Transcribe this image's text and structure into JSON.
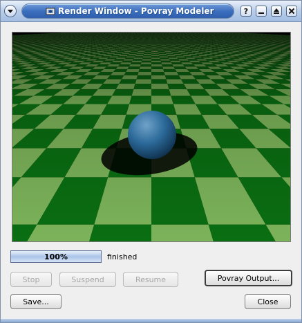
{
  "window": {
    "title": "Render Window - Povray Modeler",
    "help_label": "?",
    "minimize_label": "",
    "maximize_label": "",
    "close_label": ""
  },
  "render": {
    "progress_text": "100%",
    "progress_fraction": 1.0,
    "status": "finished"
  },
  "buttons": {
    "stop": "Stop",
    "suspend": "Suspend",
    "resume": "Resume",
    "povray_output": "Povray Output...",
    "save": "Save...",
    "close": "Close"
  },
  "colors": {
    "checker_dark": "#0a6e12",
    "checker_light": "#7cb35a",
    "sphere": "#2c6a9a",
    "sky": "#000000",
    "title_blue": "#3c6fbf"
  }
}
